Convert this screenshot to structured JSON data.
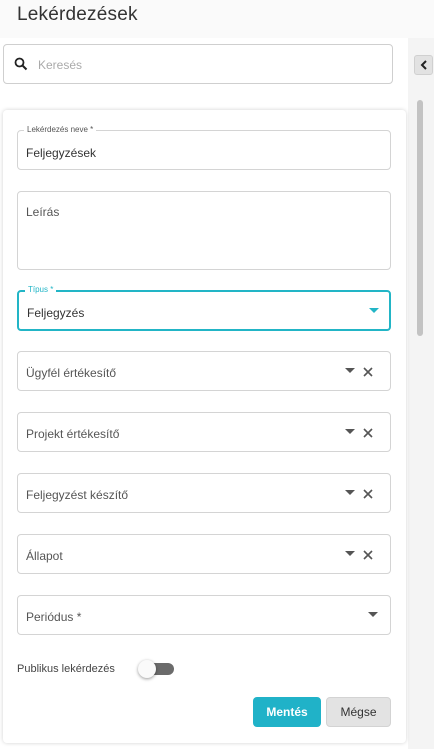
{
  "page": {
    "title": "Lekérdezések"
  },
  "search": {
    "placeholder": "Keresés",
    "value": ""
  },
  "form": {
    "name_label": "Lekérdezés neve *",
    "name_value": "Feljegyzések",
    "description_placeholder": "Leírás",
    "type_label": "Típus *",
    "type_value": "Feljegyzés",
    "client_rep_placeholder": "Ügyfél értékesítő",
    "project_rep_placeholder": "Projekt értékesítő",
    "note_creator_placeholder": "Feljegyzést készítő",
    "status_placeholder": "Állapot",
    "period_placeholder": "Periódus *",
    "public_query_label": "Publikus lekérdezés",
    "public_query_on": false
  },
  "buttons": {
    "save": "Mentés",
    "cancel": "Mégse"
  },
  "colors": {
    "accent": "#20b2c8",
    "focus_border": "#22b5c6",
    "toggle_track": "#6b6b6b"
  },
  "icons": {
    "search": "search-icon",
    "collapse": "chevron-left-icon",
    "dropdown": "caret-down-icon",
    "clear": "close-icon"
  }
}
